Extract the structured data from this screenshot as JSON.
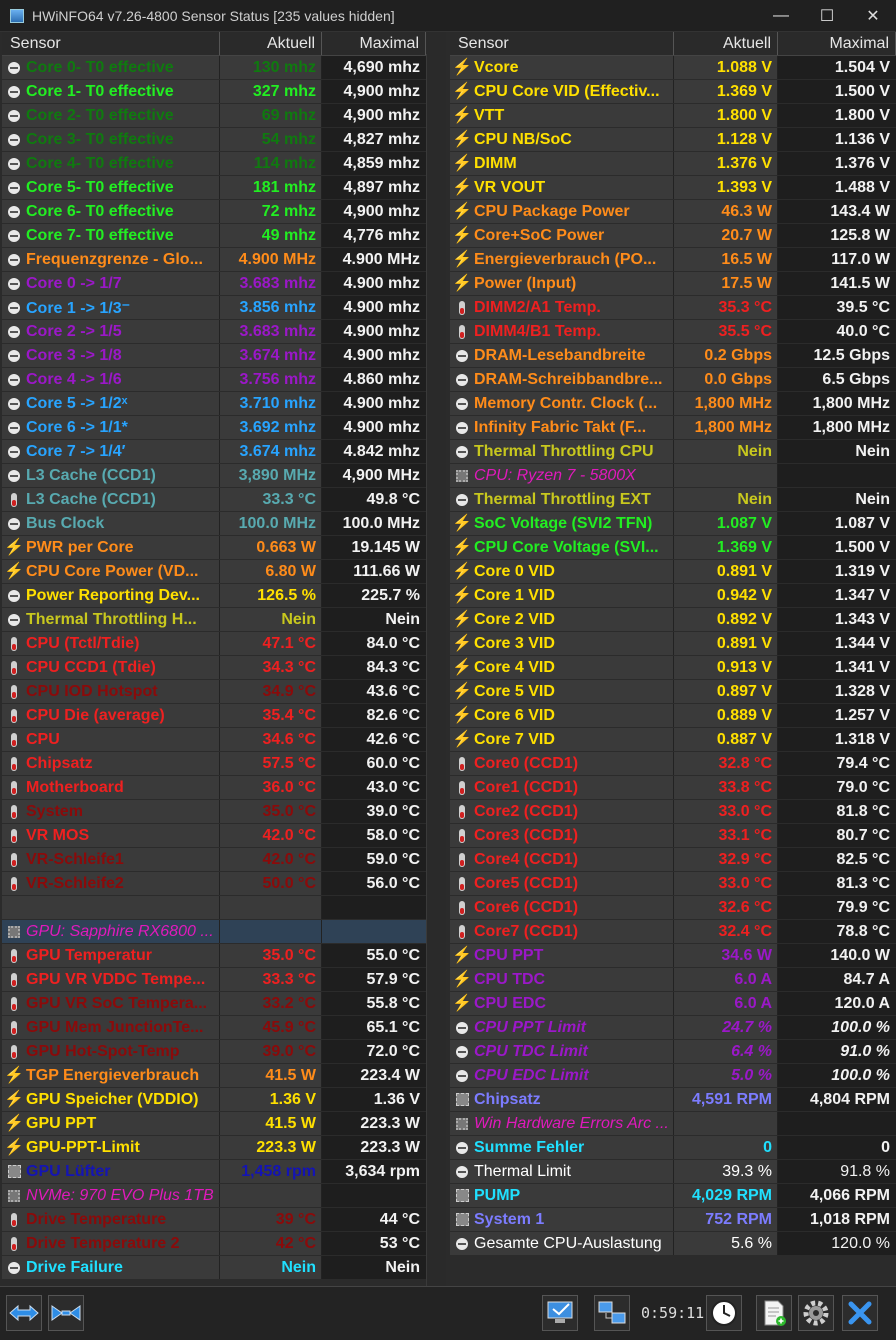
{
  "window": {
    "title": "HWiNFO64 v7.26-4800 Sensor Status [235 values hidden]",
    "minimize": "—",
    "maximize": "☐",
    "close": "✕"
  },
  "columns": {
    "sensor": "Sensor",
    "current": "Aktuell",
    "max": "Maximal"
  },
  "colors": {
    "dark_green": "#0f7a0f",
    "green": "#22ee22",
    "orange": "#ff8c1a",
    "purple": "#9b18c8",
    "blue": "#28a4ff",
    "teal": "#58aab0",
    "yellow": "#ffe000",
    "olive": "#c8c81e",
    "red": "#ee2020",
    "dark_red": "#8b0a0a",
    "magenta": "#e01abc",
    "lavender": "#7c7cff",
    "cyan": "#20e0ff",
    "navy": "#1414b4",
    "white": "#ffffff"
  },
  "left_rows": [
    {
      "icon": "circle",
      "name": "Core 0- T0 effective",
      "cur": "130 mhz",
      "max": "4,690 mhz",
      "color": "dark_green"
    },
    {
      "icon": "circle",
      "name": "Core 1- T0 effective",
      "cur": "327 mhz",
      "max": "4,900 mhz",
      "color": "green"
    },
    {
      "icon": "circle",
      "name": "Core 2- T0 effective",
      "cur": "69 mhz",
      "max": "4,900 mhz",
      "color": "dark_green"
    },
    {
      "icon": "circle",
      "name": "Core 3- T0 effective",
      "cur": "54 mhz",
      "max": "4,827 mhz",
      "color": "dark_green"
    },
    {
      "icon": "circle",
      "name": "Core 4- T0 effective",
      "cur": "114 mhz",
      "max": "4,859 mhz",
      "color": "dark_green"
    },
    {
      "icon": "circle",
      "name": "Core 5- T0 effective",
      "cur": "181 mhz",
      "max": "4,897 mhz",
      "color": "green"
    },
    {
      "icon": "circle",
      "name": "Core 6- T0 effective",
      "cur": "72 mhz",
      "max": "4,900 mhz",
      "color": "green"
    },
    {
      "icon": "circle",
      "name": "Core 7- T0 effective",
      "cur": "49 mhz",
      "max": "4,776 mhz",
      "color": "green"
    },
    {
      "icon": "circle",
      "name": "Frequenzgrenze - Glo...",
      "cur": "4.900 MHz",
      "max": "4.900 MHz",
      "color": "orange"
    },
    {
      "icon": "circle",
      "name": "Core 0   -> 1/7",
      "cur": "3.683 mhz",
      "max": "4.900 mhz",
      "color": "purple"
    },
    {
      "icon": "circle",
      "name": "Core 1   -> 1/3⁻",
      "cur": "3.856 mhz",
      "max": "4.900 mhz",
      "color": "blue"
    },
    {
      "icon": "circle",
      "name": "Core 2   -> 1/5",
      "cur": "3.683 mhz",
      "max": "4.900 mhz",
      "color": "purple"
    },
    {
      "icon": "circle",
      "name": "Core 3   -> 1/8",
      "cur": "3.674 mhz",
      "max": "4.900 mhz",
      "color": "purple"
    },
    {
      "icon": "circle",
      "name": "Core 4   -> 1/6",
      "cur": "3.756 mhz",
      "max": "4.860 mhz",
      "color": "purple"
    },
    {
      "icon": "circle",
      "name": "Core 5   -> 1/2ˣ",
      "cur": "3.710 mhz",
      "max": "4.900 mhz",
      "color": "blue"
    },
    {
      "icon": "circle",
      "name": "Core 6   -> 1/1*",
      "cur": "3.692 mhz",
      "max": "4.900 mhz",
      "color": "blue"
    },
    {
      "icon": "circle",
      "name": "Core 7   -> 1/4′",
      "cur": "3.674 mhz",
      "max": "4.842 mhz",
      "color": "blue"
    },
    {
      "icon": "circle",
      "name": "L3 Cache (CCD1)",
      "cur": "3,890 MHz",
      "max": "4,900 MHz",
      "color": "teal"
    },
    {
      "icon": "therm",
      "name": "L3 Cache (CCD1)",
      "cur": "33.3 °C",
      "max": "49.8 °C",
      "color": "teal"
    },
    {
      "icon": "circle",
      "name": "Bus Clock",
      "cur": "100.0 MHz",
      "max": "100.0 MHz",
      "color": "teal"
    },
    {
      "icon": "bolt",
      "name": "PWR per Core",
      "cur": "0.663 W",
      "max": "19.145 W",
      "color": "orange"
    },
    {
      "icon": "bolt",
      "name": "CPU Core Power (VD...",
      "cur": "6.80 W",
      "max": "111.66 W",
      "color": "orange"
    },
    {
      "icon": "circle",
      "name": "Power Reporting Dev...",
      "cur": "126.5 %",
      "max": "225.7 %",
      "color": "yellow"
    },
    {
      "icon": "circle",
      "name": "Thermal Throttling H...",
      "cur": "Nein",
      "max": "Nein",
      "color": "olive"
    },
    {
      "icon": "therm",
      "name": "CPU (Tctl/Tdie)",
      "cur": "47.1 °C",
      "max": "84.0 °C",
      "color": "red"
    },
    {
      "icon": "therm",
      "name": "CPU CCD1 (Tdie)",
      "cur": "34.3 °C",
      "max": "84.3 °C",
      "color": "red"
    },
    {
      "icon": "therm",
      "name": "CPU IOD Hotspot",
      "cur": "34.9 °C",
      "max": "43.6 °C",
      "color": "dark_red"
    },
    {
      "icon": "therm",
      "name": "CPU Die (average)",
      "cur": "35.4 °C",
      "max": "82.6 °C",
      "color": "red"
    },
    {
      "icon": "therm",
      "name": "CPU",
      "cur": "34.6 °C",
      "max": "42.6 °C",
      "color": "red"
    },
    {
      "icon": "therm",
      "name": "Chipsatz",
      "cur": "57.5 °C",
      "max": "60.0 °C",
      "color": "red"
    },
    {
      "icon": "therm",
      "name": "Motherboard",
      "cur": "36.0 °C",
      "max": "43.0 °C",
      "color": "red"
    },
    {
      "icon": "therm",
      "name": "System",
      "cur": "35.0 °C",
      "max": "39.0 °C",
      "color": "dark_red"
    },
    {
      "icon": "therm",
      "name": "VR MOS",
      "cur": "42.0 °C",
      "max": "58.0 °C",
      "color": "red"
    },
    {
      "icon": "therm",
      "name": "VR-Schleife1",
      "cur": "42.0 °C",
      "max": "59.0 °C",
      "color": "dark_red"
    },
    {
      "icon": "therm",
      "name": "VR-Schleife2",
      "cur": "50.0 °C",
      "max": "56.0 °C",
      "color": "dark_red"
    },
    {
      "kind": "empty"
    },
    {
      "kind": "group",
      "icon": "chip",
      "name": "GPU: Sapphire RX6800 ...",
      "color": "magenta",
      "selected": true
    },
    {
      "icon": "therm",
      "name": "GPU Temperatur",
      "cur": "35.0 °C",
      "max": "55.0 °C",
      "color": "red"
    },
    {
      "icon": "therm",
      "name": "GPU VR VDDC Tempe...",
      "cur": "33.3 °C",
      "max": "57.9 °C",
      "color": "red"
    },
    {
      "icon": "therm",
      "name": "GPU VR SoC Tempera...",
      "cur": "33.2 °C",
      "max": "55.8 °C",
      "color": "dark_red"
    },
    {
      "icon": "therm",
      "name": "GPU Mem JunctionTe...",
      "cur": "45.9 °C",
      "max": "65.1 °C",
      "color": "dark_red"
    },
    {
      "icon": "therm",
      "name": "GPU Hot-Spot-Temp",
      "cur": "39.0 °C",
      "max": "72.0 °C",
      "color": "dark_red"
    },
    {
      "icon": "bolt",
      "name": "TGP Energieverbrauch",
      "cur": "41.5 W",
      "max": "223.4 W",
      "color": "orange"
    },
    {
      "icon": "bolt",
      "name": "GPU Speicher (VDDIO)",
      "cur": "1.36 V",
      "max": "1.36 V",
      "color": "yellow"
    },
    {
      "icon": "bolt",
      "name": "GPU PPT",
      "cur": "41.5 W",
      "max": "223.3 W",
      "color": "yellow"
    },
    {
      "icon": "bolt",
      "name": "GPU-PPT-Limit",
      "cur": "223.3 W",
      "max": "223.3 W",
      "color": "yellow"
    },
    {
      "icon": "fan",
      "name": "GPU Lüfter",
      "cur": "1,458 rpm",
      "max": "3,634 rpm",
      "color": "navy"
    },
    {
      "kind": "group",
      "icon": "chip",
      "name": "NVMe: 970 EVO Plus 1TB",
      "color": "magenta"
    },
    {
      "icon": "therm",
      "name": "Drive Temperature",
      "cur": "39 °C",
      "max": "44 °C",
      "color": "dark_red"
    },
    {
      "icon": "therm",
      "name": "Drive Temperature 2",
      "cur": "42 °C",
      "max": "53 °C",
      "color": "dark_red"
    },
    {
      "icon": "circle",
      "name": "Drive Failure",
      "cur": "Nein",
      "max": "Nein",
      "color": "cyan"
    }
  ],
  "right_rows": [
    {
      "icon": "bolt",
      "name": "Vcore",
      "cur": "1.088 V",
      "max": "1.504 V",
      "color": "yellow"
    },
    {
      "icon": "bolt",
      "name": "CPU Core VID (Effectiv...",
      "cur": "1.369 V",
      "max": "1.500 V",
      "color": "yellow"
    },
    {
      "icon": "bolt",
      "name": "VTT",
      "cur": "1.800 V",
      "max": "1.800 V",
      "color": "yellow"
    },
    {
      "icon": "bolt",
      "name": "CPU NB/SoC",
      "cur": "1.128 V",
      "max": "1.136 V",
      "color": "yellow"
    },
    {
      "icon": "bolt",
      "name": "DIMM",
      "cur": "1.376 V",
      "max": "1.376 V",
      "color": "yellow"
    },
    {
      "icon": "bolt",
      "name": "VR VOUT",
      "cur": "1.393 V",
      "max": "1.488 V",
      "color": "yellow"
    },
    {
      "icon": "bolt",
      "name": "CPU Package Power",
      "cur": "46.3 W",
      "max": "143.4 W",
      "color": "orange"
    },
    {
      "icon": "bolt",
      "name": "Core+SoC Power",
      "cur": "20.7 W",
      "max": "125.8 W",
      "color": "orange"
    },
    {
      "icon": "bolt",
      "name": "Energieverbrauch (PO...",
      "cur": "16.5 W",
      "max": "117.0 W",
      "color": "orange"
    },
    {
      "icon": "bolt",
      "name": "Power (Input)",
      "cur": "17.5 W",
      "max": "141.5 W",
      "color": "orange"
    },
    {
      "icon": "therm",
      "name": "DIMM2/A1 Temp.",
      "cur": "35.3 °C",
      "max": "39.5 °C",
      "color": "red"
    },
    {
      "icon": "therm",
      "name": "DIMM4/B1 Temp.",
      "cur": "35.5 °C",
      "max": "40.0 °C",
      "color": "red"
    },
    {
      "icon": "circle",
      "name": "DRAM-Lesebandbreite",
      "cur": "0.2 Gbps",
      "max": "12.5 Gbps",
      "color": "orange"
    },
    {
      "icon": "circle",
      "name": "DRAM-Schreibbandbre...",
      "cur": "0.0 Gbps",
      "max": "6.5 Gbps",
      "color": "orange"
    },
    {
      "icon": "circle",
      "name": "Memory Contr. Clock (...",
      "cur": "1,800 MHz",
      "max": "1,800 MHz",
      "color": "orange"
    },
    {
      "icon": "circle",
      "name": "Infinity Fabric Takt (F...",
      "cur": "1,800 MHz",
      "max": "1,800 MHz",
      "color": "orange"
    },
    {
      "icon": "circle",
      "name": "Thermal Throttling CPU",
      "cur": "Nein",
      "max": "Nein",
      "color": "olive"
    },
    {
      "kind": "group",
      "icon": "chip",
      "name": "CPU: Ryzen 7 - 5800X",
      "color": "magenta"
    },
    {
      "icon": "circle",
      "name": "Thermal Throttling  EXT",
      "cur": "Nein",
      "max": "Nein",
      "color": "olive"
    },
    {
      "icon": "bolt",
      "name": "SoC Voltage (SVI2 TFN)",
      "cur": "1.087 V",
      "max": "1.087 V",
      "color": "green"
    },
    {
      "icon": "bolt",
      "name": "CPU Core Voltage (SVI...",
      "cur": "1.369 V",
      "max": "1.500 V",
      "color": "green"
    },
    {
      "icon": "bolt",
      "name": "Core 0 VID",
      "cur": "0.891 V",
      "max": "1.319 V",
      "color": "yellow"
    },
    {
      "icon": "bolt",
      "name": "Core 1 VID",
      "cur": "0.942 V",
      "max": "1.347 V",
      "color": "yellow"
    },
    {
      "icon": "bolt",
      "name": "Core 2 VID",
      "cur": "0.892 V",
      "max": "1.343 V",
      "color": "yellow"
    },
    {
      "icon": "bolt",
      "name": "Core 3 VID",
      "cur": "0.891 V",
      "max": "1.344 V",
      "color": "yellow"
    },
    {
      "icon": "bolt",
      "name": "Core 4 VID",
      "cur": "0.913 V",
      "max": "1.341 V",
      "color": "yellow"
    },
    {
      "icon": "bolt",
      "name": "Core 5 VID",
      "cur": "0.897 V",
      "max": "1.328 V",
      "color": "yellow"
    },
    {
      "icon": "bolt",
      "name": "Core 6 VID",
      "cur": "0.889 V",
      "max": "1.257 V",
      "color": "yellow"
    },
    {
      "icon": "bolt",
      "name": "Core 7 VID",
      "cur": "0.887 V",
      "max": "1.318 V",
      "color": "yellow"
    },
    {
      "icon": "therm",
      "name": "Core0 (CCD1)",
      "cur": "32.8 °C",
      "max": "79.4 °C",
      "color": "red"
    },
    {
      "icon": "therm",
      "name": "Core1 (CCD1)",
      "cur": "33.8 °C",
      "max": "79.0 °C",
      "color": "red"
    },
    {
      "icon": "therm",
      "name": "Core2 (CCD1)",
      "cur": "33.0 °C",
      "max": "81.8 °C",
      "color": "red"
    },
    {
      "icon": "therm",
      "name": "Core3 (CCD1)",
      "cur": "33.1 °C",
      "max": "80.7 °C",
      "color": "red"
    },
    {
      "icon": "therm",
      "name": "Core4 (CCD1)",
      "cur": "32.9 °C",
      "max": "82.5 °C",
      "color": "red"
    },
    {
      "icon": "therm",
      "name": "Core5 (CCD1)",
      "cur": "33.0 °C",
      "max": "81.3 °C",
      "color": "red"
    },
    {
      "icon": "therm",
      "name": "Core6 (CCD1)",
      "cur": "32.6 °C",
      "max": "79.9 °C",
      "color": "red"
    },
    {
      "icon": "therm",
      "name": "Core7 (CCD1)",
      "cur": "32.4 °C",
      "max": "78.8 °C",
      "color": "red"
    },
    {
      "icon": "bolt",
      "name": "CPU PPT",
      "cur": "34.6 W",
      "max": "140.0 W",
      "color": "purple"
    },
    {
      "icon": "bolt",
      "name": "CPU TDC",
      "cur": "6.0 A",
      "max": "84.7 A",
      "color": "purple"
    },
    {
      "icon": "bolt",
      "name": "CPU EDC",
      "cur": "6.0 A",
      "max": "120.0 A",
      "color": "purple"
    },
    {
      "icon": "circle",
      "name": "CPU PPT Limit",
      "cur": "24.7 %",
      "max": "100.0 %",
      "color": "purple",
      "italic": true
    },
    {
      "icon": "circle",
      "name": "CPU TDC Limit",
      "cur": "6.4 %",
      "max": "91.0 %",
      "color": "purple",
      "italic": true
    },
    {
      "icon": "circle",
      "name": "CPU EDC Limit",
      "cur": "5.0 %",
      "max": "100.0 %",
      "color": "purple",
      "italic": true
    },
    {
      "icon": "fan",
      "name": "Chipsatz",
      "cur": "4,591 RPM",
      "max": "4,804 RPM",
      "color": "lavender"
    },
    {
      "kind": "group",
      "icon": "chip",
      "name": "Win Hardware Errors Arc ...",
      "color": "magenta"
    },
    {
      "icon": "circle",
      "name": "Summe Fehler",
      "cur": "0",
      "max": "0",
      "color": "cyan"
    },
    {
      "icon": "circle",
      "name": "Thermal Limit",
      "cur": "39.3 %",
      "max": "91.8 %",
      "color": "white",
      "normal": true
    },
    {
      "icon": "fan",
      "name": "PUMP",
      "cur": "4,029 RPM",
      "max": "4,066 RPM",
      "color": "cyan"
    },
    {
      "icon": "fan",
      "name": "System 1",
      "cur": "752 RPM",
      "max": "1,018 RPM",
      "color": "lavender"
    },
    {
      "icon": "circle",
      "name": "Gesamte CPU-Auslastung",
      "cur": "5.6 %",
      "max": "120.0 %",
      "color": "white",
      "normal": true
    }
  ],
  "bottombar": {
    "timer": "0:59:11",
    "buttons": [
      "nav-arrows-icon",
      "nav-collapse-icon",
      "report-monitor-icon",
      "network-icon",
      "clock-icon",
      "log-file-icon",
      "settings-gear-icon",
      "close-x-icon"
    ]
  }
}
